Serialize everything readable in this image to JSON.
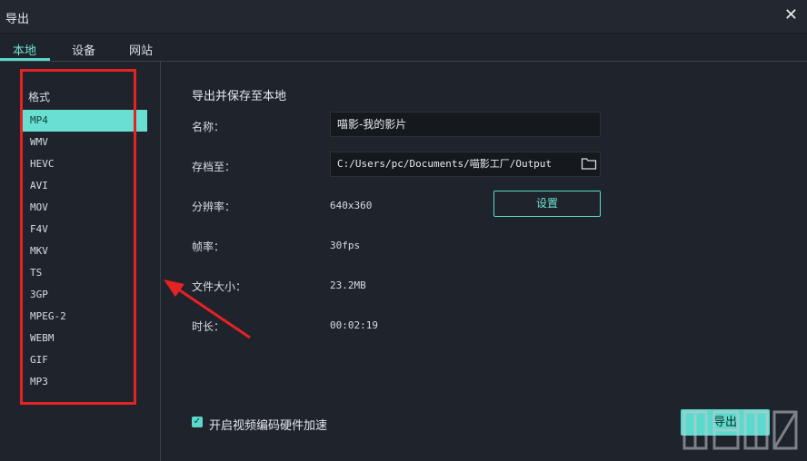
{
  "window": {
    "title": "导出",
    "close_icon": "close-icon"
  },
  "tabs": [
    {
      "label": "本地",
      "active": true
    },
    {
      "label": "设备",
      "active": false
    },
    {
      "label": "网站",
      "active": false
    }
  ],
  "sidebar": {
    "title": "格式",
    "formats": [
      "MP4",
      "WMV",
      "HEVC",
      "AVI",
      "MOV",
      "F4V",
      "MKV",
      "TS",
      "3GP",
      "MPEG-2",
      "WEBM",
      "GIF",
      "MP3"
    ],
    "selected": "MP4"
  },
  "main": {
    "section_title": "导出并保存至本地",
    "name_label": "名称：",
    "name_value": "喵影-我的影片",
    "path_label": "存档至：",
    "path_value": "C:/Users/pc/Documents/喵影工厂/Output",
    "resolution_label": "分辨率：",
    "resolution_value": "640x360",
    "settings_button": "设置",
    "framerate_label": "帧率：",
    "framerate_value": "30fps",
    "filesize_label": "文件大小：",
    "filesize_value": "23.2MB",
    "duration_label": "时长：",
    "duration_value": "00:02:19",
    "hw_accel_label": "开启视频编码硬件加速",
    "hw_accel_checked": true,
    "export_button": "导出"
  },
  "colors": {
    "accent": "#5ad9cc",
    "background": "#1f242c",
    "annotation_red": "#e52224"
  }
}
